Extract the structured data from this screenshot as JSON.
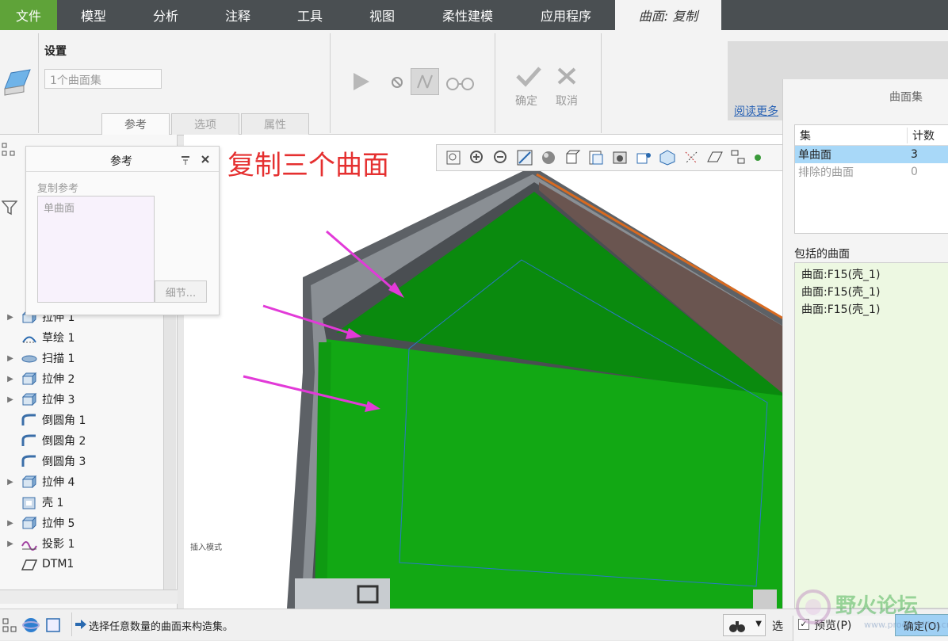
{
  "menu": {
    "file": "文件",
    "tabs": [
      "模型",
      "分析",
      "注释",
      "工具",
      "视图",
      "柔性建模",
      "应用程序"
    ],
    "active_tab": "曲面: 复制"
  },
  "ribbon": {
    "settings_label": "设置",
    "surface_set_placeholder": "1个曲面集",
    "confirm_label": "确定",
    "cancel_label": "取消",
    "read_more": "阅读更多",
    "tabs": [
      "参考",
      "选项",
      "属性"
    ]
  },
  "ref_popup": {
    "title": "参考",
    "copy_ref_label": "复制参考",
    "list_item": "单曲面",
    "details_button": "细节..."
  },
  "annotation": "复制三个曲面",
  "tree": {
    "items": [
      {
        "label": "拉伸 1",
        "icon": "extrude-icon",
        "expandable": true
      },
      {
        "label": "草绘 1",
        "icon": "sketch-icon",
        "expandable": false
      },
      {
        "label": "扫描 1",
        "icon": "sweep-icon",
        "expandable": true
      },
      {
        "label": "拉伸 2",
        "icon": "extrude-icon",
        "expandable": true
      },
      {
        "label": "拉伸 3",
        "icon": "extrude-icon",
        "expandable": true
      },
      {
        "label": "倒圆角 1",
        "icon": "round-icon",
        "expandable": false
      },
      {
        "label": "倒圆角 2",
        "icon": "round-icon",
        "expandable": false
      },
      {
        "label": "倒圆角 3",
        "icon": "round-icon",
        "expandable": false
      },
      {
        "label": "拉伸 4",
        "icon": "extrude-icon",
        "expandable": true
      },
      {
        "label": "壳 1",
        "icon": "shell-icon",
        "expandable": false
      },
      {
        "label": "拉伸 5",
        "icon": "extrude-icon",
        "expandable": true
      },
      {
        "label": "投影 1",
        "icon": "project-icon",
        "expandable": true
      },
      {
        "label": "DTM1",
        "icon": "datum-plane-icon",
        "expandable": false
      }
    ]
  },
  "viewport": {
    "insert_mode_label": "插入模式"
  },
  "right_panel": {
    "title": "曲面集",
    "table_headers": [
      "集",
      "计数"
    ],
    "rows": [
      {
        "set": "单曲面",
        "count": "3"
      },
      {
        "set": "排除的曲面",
        "count": "0"
      }
    ],
    "included_label": "包括的曲面",
    "included": [
      "曲面:F15(壳_1)",
      "曲面:F15(壳_1)",
      "曲面:F15(壳_1)"
    ]
  },
  "status": {
    "message": "选择任意数量的曲面来构造集。",
    "select_prefix": "选",
    "preview_label": "预览(P)",
    "ok_label": "确定(O)",
    "watermark": "野火论坛",
    "watermark_url": "www.proewildfire.cn"
  },
  "colors": {
    "menu_bg": "#4a4f52",
    "file_tab": "#5fa339",
    "surface_green": "#0d9a10",
    "arrow_magenta": "#e23ad8",
    "annotation_red": "#e53030",
    "selection_blue": "#a8d8f8"
  }
}
